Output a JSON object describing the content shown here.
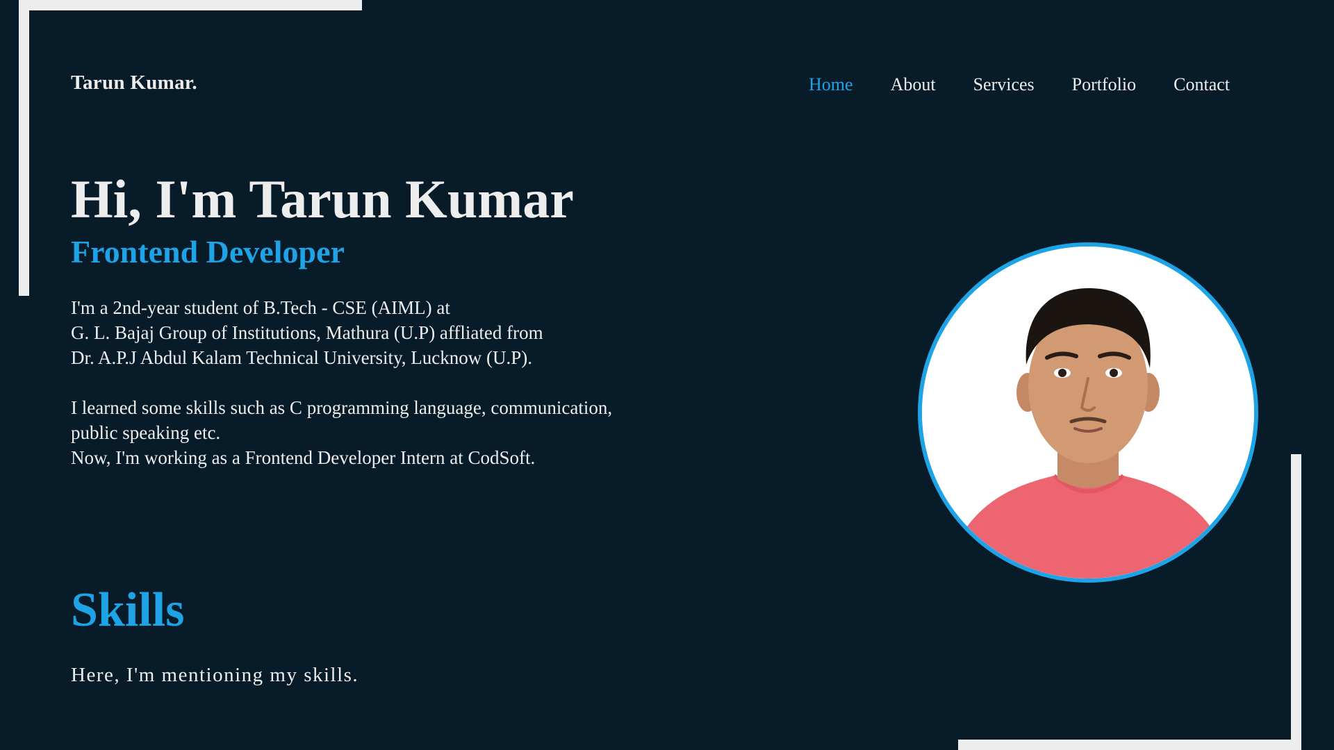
{
  "header": {
    "logo": "Tarun Kumar.",
    "nav": [
      {
        "label": "Home",
        "active": true
      },
      {
        "label": "About",
        "active": false
      },
      {
        "label": "Services",
        "active": false
      },
      {
        "label": "Portfolio",
        "active": false
      },
      {
        "label": "Contact",
        "active": false
      }
    ]
  },
  "hero": {
    "title": "Hi, I'm Tarun Kumar",
    "role": "Frontend Developer",
    "bio_lines_1": [
      "I'm a 2nd-year student of B.Tech - CSE (AIML) at",
      "G. L. Bajaj Group of Institutions, Mathura (U.P) affliated from",
      "Dr. A.P.J Abdul Kalam Technical University, Lucknow (U.P)."
    ],
    "bio_lines_2": [
      "I learned some skills such as C programming language, communication,",
      "public speaking etc.",
      "Now, I'm working as a Frontend Developer Intern at CodSoft."
    ]
  },
  "skills": {
    "title": "Skills",
    "subtitle": "Here, I'm mentioning my skills."
  },
  "colors": {
    "background": "#081b29",
    "accent": "#1ea3e6",
    "text": "#ededed"
  }
}
